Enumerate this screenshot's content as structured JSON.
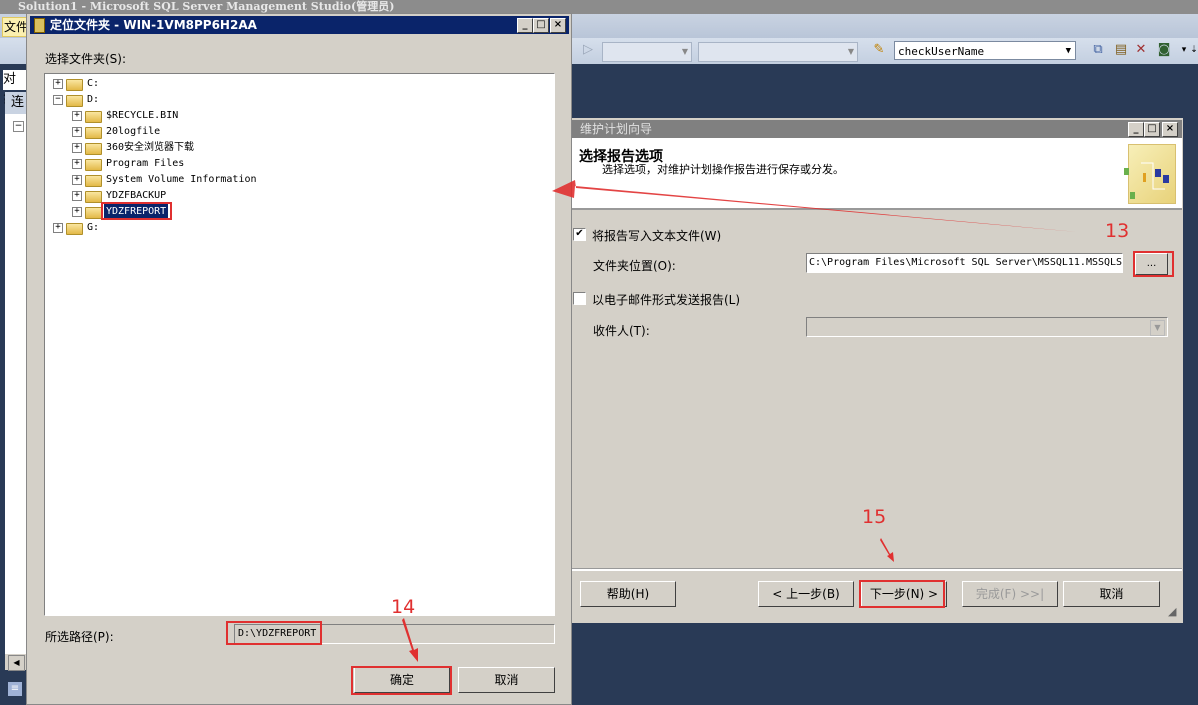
{
  "app": {
    "title": "Solution1 - Microsoft SQL Server Management Studio(管理员)",
    "menu_file": "文件",
    "toolbar": {
      "object_name_combo": "checkUserName"
    },
    "explorer": {
      "tab_label": "对象",
      "connect_label": "连",
      "collapse_symbol": "−"
    }
  },
  "folder_dialog": {
    "title": "定位文件夹 - WIN-1VM8PP6H2AA",
    "select_label": "选择文件夹(S):",
    "tree": [
      {
        "label": "C:",
        "level": 0,
        "expander": "+",
        "selected": false
      },
      {
        "label": "D:",
        "level": 0,
        "expander": "−",
        "selected": false
      },
      {
        "label": "$RECYCLE.BIN",
        "level": 1,
        "expander": "+",
        "selected": false
      },
      {
        "label": "20logfile",
        "level": 1,
        "expander": "+",
        "selected": false
      },
      {
        "label": "360安全浏览器下载",
        "level": 1,
        "expander": "+",
        "selected": false
      },
      {
        "label": "Program Files",
        "level": 1,
        "expander": "+",
        "selected": false
      },
      {
        "label": "System Volume Information",
        "level": 1,
        "expander": "+",
        "selected": false
      },
      {
        "label": "YDZFBACKUP",
        "level": 1,
        "expander": "+",
        "selected": false
      },
      {
        "label": "YDZFREPORT",
        "level": 1,
        "expander": "+",
        "selected": true
      },
      {
        "label": "G:",
        "level": 0,
        "expander": "+",
        "selected": false
      }
    ],
    "path_label": "所选路径(P):",
    "path_value": "D:\\YDZFREPORT",
    "ok_label": "确定",
    "cancel_label": "取消"
  },
  "wizard": {
    "title": "维护计划向导",
    "heading": "选择报告选项",
    "subheading": "选择选项，对维护计划操作报告进行保存或分发。",
    "write_text_file_label": "将报告写入文本文件(W)",
    "write_text_file_checked": true,
    "folder_location_label": "文件夹位置(O):",
    "folder_location_value": "C:\\Program Files\\Microsoft SQL Server\\MSSQL11.MSSQLS",
    "browse_label": "...",
    "email_report_label": "以电子邮件形式发送报告(L)",
    "email_report_checked": false,
    "recipient_label": "收件人(T):",
    "recipient_value": "",
    "buttons": {
      "help": "帮助(H)",
      "back": "< 上一步(B)",
      "next": "下一步(N) >",
      "finish": "完成(F) >>|",
      "cancel": "取消"
    }
  },
  "annotations": {
    "step13": "13",
    "step14": "14",
    "step15": "15",
    "color": "#e03030"
  },
  "window_buttons": {
    "minimize": "_",
    "maximize": "□",
    "close": "×"
  }
}
